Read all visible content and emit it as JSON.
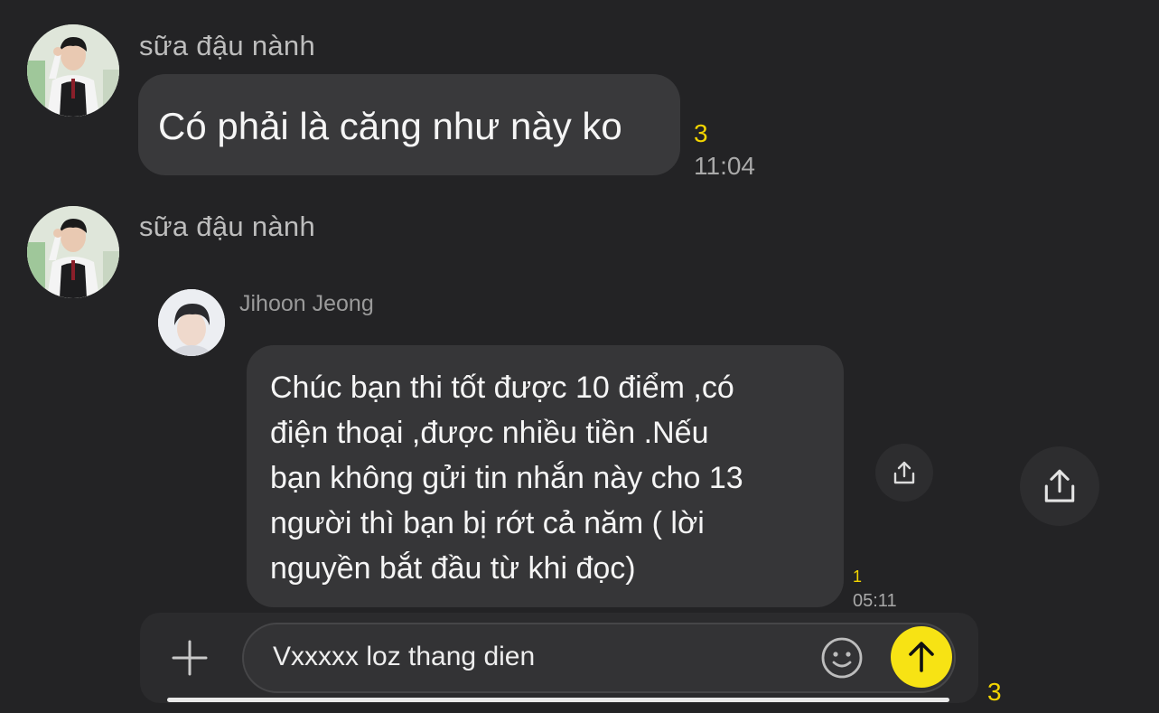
{
  "messages": [
    {
      "sender": "sữa đậu nành",
      "text": "Có phải là căng như này ko",
      "unread": "3",
      "time": "11:04"
    },
    {
      "sender": "sữa đậu nành",
      "forwarded": {
        "sender": "Jihoon Jeong",
        "lines": [
          "Chúc bạn thi tốt được 10 điểm ,có",
          "điện thoại ,được nhiều tiền .Nếu",
          "bạn không gửi tin nhắn này cho 13",
          "người thì bạn bị rớt cả năm ( lời",
          "nguyền bắt đầu từ khi đọc)"
        ],
        "unread": "1",
        "time": "05:11"
      }
    }
  ],
  "composer": {
    "value": "Vxxxxx loz thang dien",
    "icons": {
      "add": "plus-icon",
      "emoji": "emoji-icon",
      "send": "arrow-up-icon",
      "share": "share-icon"
    }
  },
  "outer_unread": "3",
  "colors": {
    "background": "#232325",
    "bubble": "#39393b",
    "accent": "#f7e314",
    "unread": "#f2d400"
  }
}
